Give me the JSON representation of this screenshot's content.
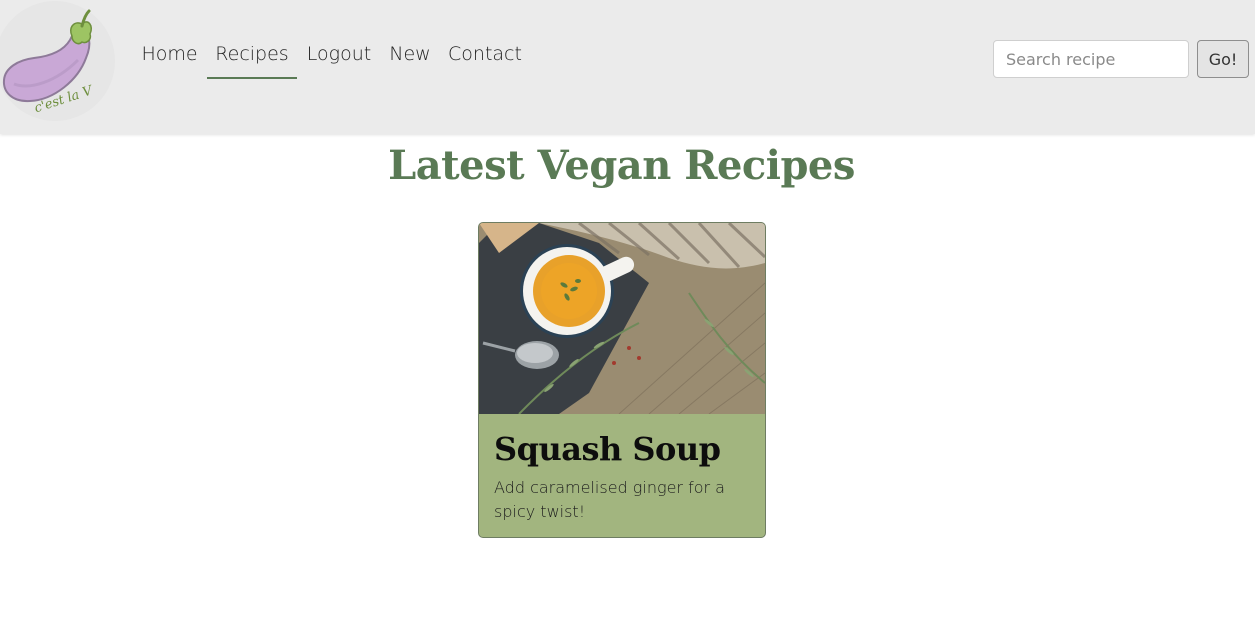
{
  "nav": {
    "items": [
      {
        "label": "Home",
        "active": false
      },
      {
        "label": "Recipes",
        "active": true
      },
      {
        "label": "Logout",
        "active": false
      },
      {
        "label": "New",
        "active": false
      },
      {
        "label": "Contact",
        "active": false
      }
    ]
  },
  "logo": {
    "text": "c'est la V",
    "icon": "eggplant-logo-icon"
  },
  "search": {
    "placeholder": "Search recipe",
    "value": "",
    "button_label": "Go!"
  },
  "main": {
    "title": "Latest Vegan Recipes"
  },
  "recipes": [
    {
      "title": "Squash Soup",
      "description": "Add caramelised ginger for a spicy twist!",
      "image": "squash-soup-photo"
    }
  ],
  "colors": {
    "navbar_bg": "#ebebeb",
    "accent_green": "#5a7a55",
    "card_bg": "#a2b57f",
    "logo_purple": "#c9a8d6"
  }
}
